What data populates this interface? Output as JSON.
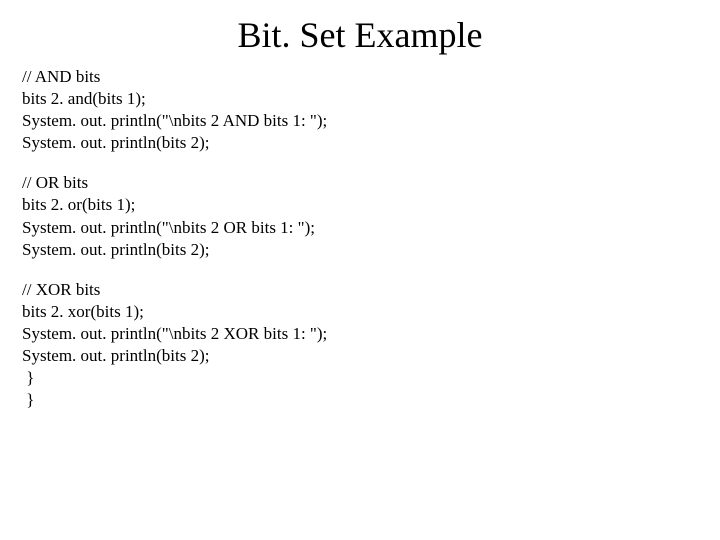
{
  "title": "Bit. Set Example",
  "blocks": [
    {
      "comment": "// AND bits",
      "lines": [
        "bits 2. and(bits 1);",
        "System. out. println(\"\\nbits 2 AND bits 1: \");",
        "System. out. println(bits 2);"
      ]
    },
    {
      "comment": "// OR bits",
      "lines": [
        "bits 2. or(bits 1);",
        "System. out. println(\"\\nbits 2 OR bits 1: \");",
        "System. out. println(bits 2);"
      ]
    },
    {
      "comment": "// XOR bits",
      "lines": [
        "bits 2. xor(bits 1);",
        "System. out. println(\"\\nbits 2 XOR bits 1: \");",
        "System. out. println(bits 2);",
        " }",
        " }"
      ]
    }
  ]
}
